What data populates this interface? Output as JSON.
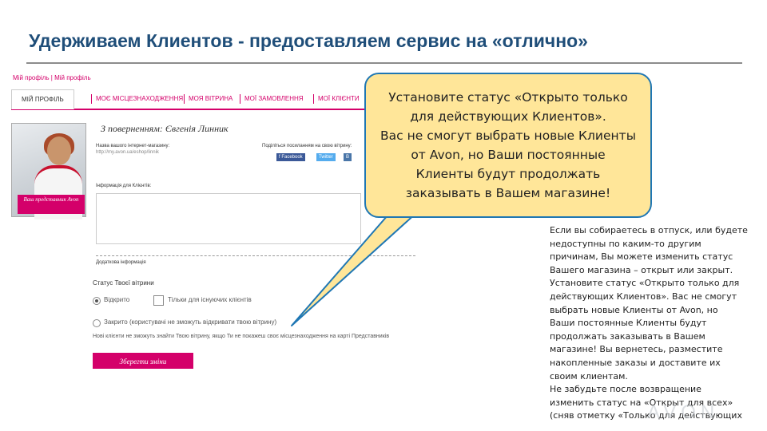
{
  "slide": {
    "title": "Удерживаем Клиентов - предоставляем сервис на «отлично»"
  },
  "shop_screenshot": {
    "breadcrumb": "Мій профіль | Мій профіль",
    "nav_tabs": [
      {
        "label": "МІЙ ПРОФІЛЬ",
        "active": true
      },
      {
        "label": "МОЄ МІСЦЕЗНАХОДЖЕННЯ",
        "active": false
      },
      {
        "label": "МОЯ ВІТРИНА",
        "active": false
      },
      {
        "label": "МОЇ ЗАМОВЛЕННЯ",
        "active": false
      },
      {
        "label": "МОЇ КЛІЄНТИ",
        "active": false
      }
    ],
    "profile_badge": "Ваш представник Avon",
    "greeting": "З поверненням: Євгенія Линник",
    "shop_url_label": "Назва вашого інтернет-магазину:",
    "shop_url_value": "http://my.avon.ua/eshop/linnik",
    "share_label": "Поділіться посиланням на свою вітрину:",
    "share_buttons": [
      {
        "label": "f Facebook",
        "color": "#3b5998"
      },
      {
        "label": "Twitter",
        "color": "#55acee"
      },
      {
        "label": "В",
        "color": "#4a76a8"
      }
    ],
    "info_label": "Інформація для Клієнтів:",
    "extra_info_label": "Додаткова інформація",
    "status_section_title": "Статус Твоєї вітрини",
    "options": {
      "open_label": "Відкрито",
      "open_checked": true,
      "existing_only_label": "Тільки для існуючих клієнтів",
      "existing_only_checked": false,
      "closed_label": "Закрито (користувачі не зможуть відкривати твою вітрину)",
      "closed_checked": false
    },
    "note": "Нові клієнти не зможуть знайти Твою вітрину, якщо Ти не покажеш своє місцезнаходження на карті Представників",
    "save_button": "Зберегти зміни"
  },
  "callout": {
    "text": "Установите статус «Открыто только\nдля действующих Клиентов».\nВас не смогут выбрать новые Клиенты\nот Avon, но Ваши постоянные\nКлиенты будут продолжать\nзаказывать в Вашем магазине!"
  },
  "side_note": {
    "text": "Если вы собираетесь в отпуск, или будете\nнедоступны по каким-то другим\nпричинам, Вы можете изменить статус\nВашего магазина – открыт или закрыт.\nУстановите статус «Открыто только для\nдействующих Клиентов». Вас не смогут\nвыбрать новые Клиенты от Avon, но\nВаши постоянные Клиенты будут\nпродолжать заказывать в Вашем\nмагазине! Вы вернетесь, разместите\nнакопленные заказы и доставите их\nсвоим клиентам.\nНе забудьте после возвращение\nизменить статус на «Открыт для всех»\n(сняв отметку «Только для действующих"
  },
  "brand": {
    "watermark": "AVON"
  },
  "colors": {
    "title": "#1f4e79",
    "accent": "#d4006a",
    "callout_fill": "#ffe699",
    "callout_border": "#1f77b4"
  }
}
